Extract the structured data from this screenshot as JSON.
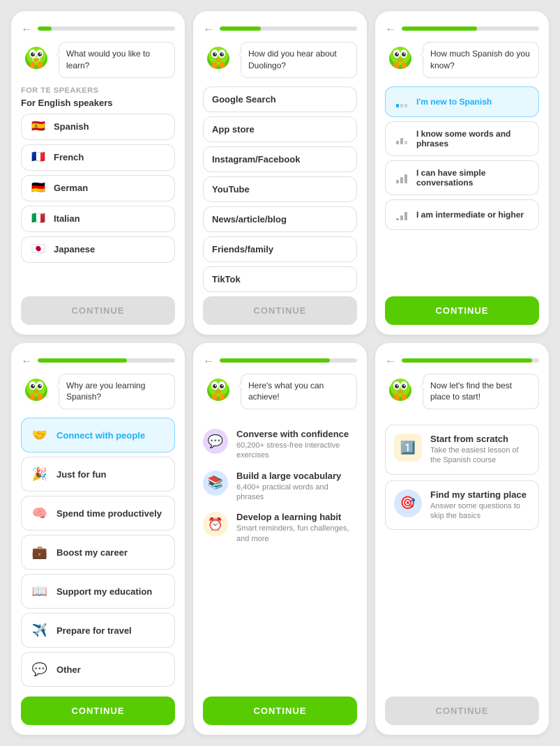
{
  "cards": [
    {
      "id": "card-language",
      "progress": 10,
      "bubble": "What would you like to learn?",
      "sectionTop": "For te speakers",
      "sectionMain": "For English speakers",
      "options": [
        {
          "label": "Spanish",
          "flag": "🇪🇸"
        },
        {
          "label": "French",
          "flag": "🇫🇷"
        },
        {
          "label": "German",
          "flag": "🇩🇪"
        },
        {
          "label": "Italian",
          "flag": "🇮🇹"
        },
        {
          "label": "Japanese",
          "flag": "🇯🇵"
        }
      ],
      "continueLabel": "CONTINUE",
      "continueActive": false
    },
    {
      "id": "card-source",
      "progress": 30,
      "bubble": "How did you hear about Duolingo?",
      "options": [
        {
          "label": "Google Search"
        },
        {
          "label": "App store"
        },
        {
          "label": "Instagram/Facebook"
        },
        {
          "label": "YouTube"
        },
        {
          "label": "News/article/blog"
        },
        {
          "label": "Friends/family"
        },
        {
          "label": "TikTok"
        }
      ],
      "continueLabel": "CONTINUE",
      "continueActive": false
    },
    {
      "id": "card-level",
      "progress": 55,
      "bubble": "How much Spanish do you know?",
      "levels": [
        {
          "label": "I'm new to Spanish",
          "bars": 1,
          "selected": true
        },
        {
          "label": "I know some words and phrases",
          "bars": 2
        },
        {
          "label": "I can have simple conversations",
          "bars": 3
        },
        {
          "label": "I am intermediate or higher",
          "bars": 4
        }
      ],
      "continueLabel": "CONTINUE",
      "continueActive": true
    },
    {
      "id": "card-goal",
      "progress": 65,
      "bubble": "Why are you learning Spanish?",
      "goals": [
        {
          "label": "Connect with people",
          "emoji": "🤝",
          "selected": true
        },
        {
          "label": "Just for fun",
          "emoji": "🎉"
        },
        {
          "label": "Spend time productively",
          "emoji": "🧠"
        },
        {
          "label": "Boost my career",
          "emoji": "💼"
        },
        {
          "label": "Support my education",
          "emoji": "📖"
        },
        {
          "label": "Prepare for travel",
          "emoji": "✈️"
        },
        {
          "label": "Other",
          "emoji": "💬"
        }
      ],
      "continueLabel": "CONTINUE",
      "continueActive": true
    },
    {
      "id": "card-achieve",
      "progress": 80,
      "bubble": "Here's what you can achieve!",
      "achievements": [
        {
          "label": "Converse with confidence",
          "desc": "60,200+ stress-free interactive exercises",
          "iconBg": "#e8d5ff",
          "iconColor": "#9b59b6",
          "icon": "💬"
        },
        {
          "label": "Build a large vocabulary",
          "desc": "6,400+ practical words and phrases",
          "iconBg": "#d5e8ff",
          "iconColor": "#3498db",
          "icon": "📚"
        },
        {
          "label": "Develop a learning habit",
          "desc": "Smart reminders, fun challenges, and more",
          "iconBg": "#fff3d5",
          "iconColor": "#f39c12",
          "icon": "⏰"
        }
      ],
      "continueLabel": "CONTINUE",
      "continueActive": true
    },
    {
      "id": "card-start",
      "progress": 95,
      "bubble": "Now let's find the best place to start!",
      "startOptions": [
        {
          "label": "Start from scratch",
          "desc": "Take the easiest lesson of the Spanish course",
          "iconBg": "#fff3d5",
          "icon": "1️⃣"
        },
        {
          "label": "Find my starting place",
          "desc": "Answer some questions to skip the basics",
          "iconBg": "#d5e8ff",
          "icon": "🎯"
        }
      ],
      "continueLabel": "CONTINUE",
      "continueActive": false
    }
  ]
}
